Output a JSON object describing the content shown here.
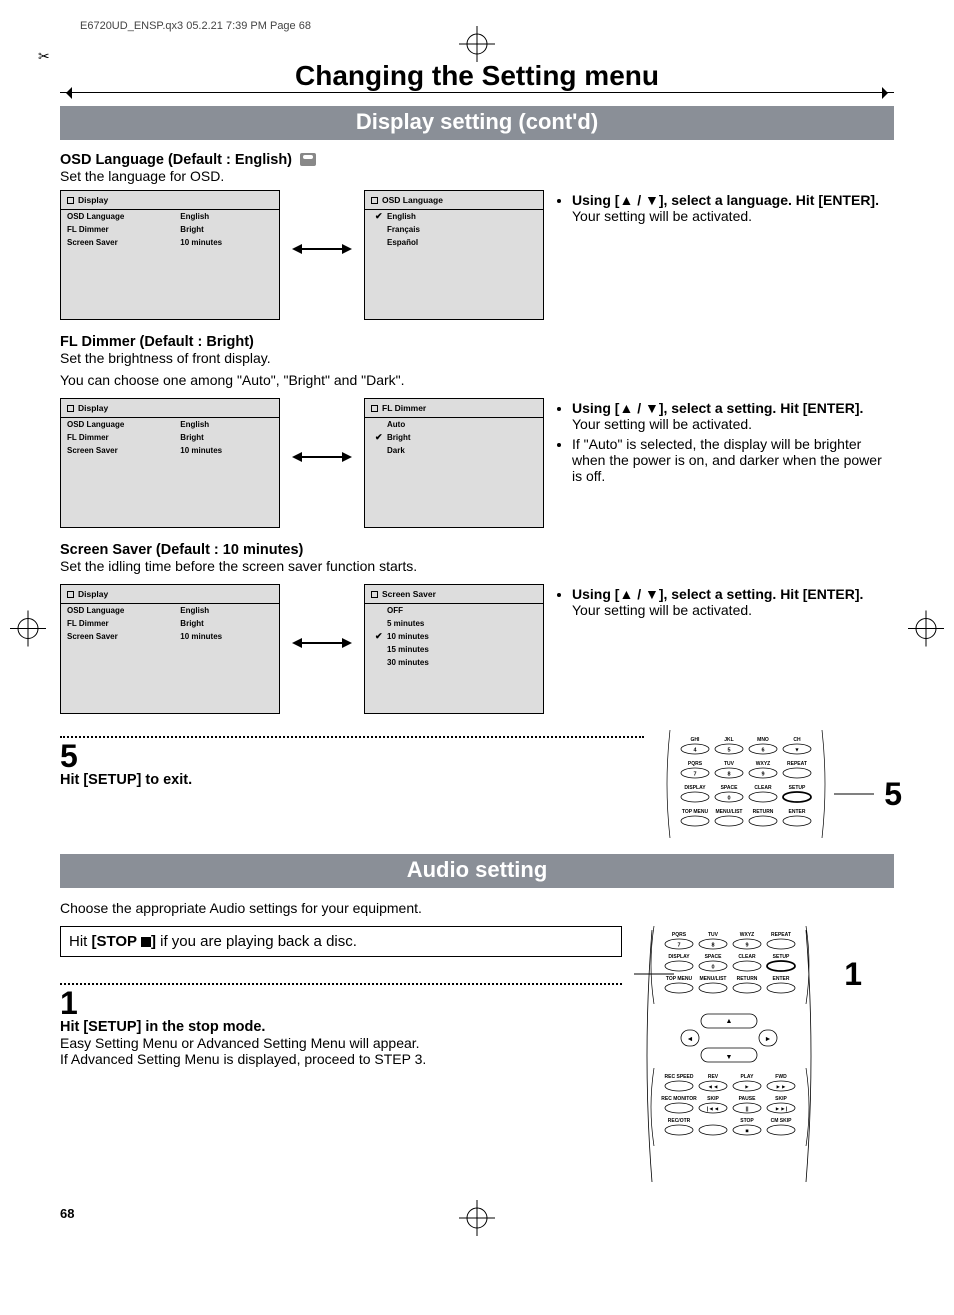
{
  "print_header": "E6720UD_ENSP.qx3  05.2.21 7:39 PM  Page 68",
  "page_number": "68",
  "chapter_title": "Changing the Setting menu",
  "band1": "Display setting (cont'd)",
  "band2": "Audio setting",
  "osd_lang": {
    "heading": "OSD Language (Default : English)",
    "sub": "Set the language for OSD.",
    "left_panel": {
      "title": "Display",
      "rows": [
        {
          "k": "OSD Language",
          "v": "English"
        },
        {
          "k": "FL Dimmer",
          "v": "Bright"
        },
        {
          "k": "Screen Saver",
          "v": "10 minutes"
        }
      ]
    },
    "right_panel": {
      "title": "OSD Language",
      "options": [
        "English",
        "Français",
        "Español"
      ],
      "selected": "English"
    },
    "instr_bold": "Using [▲ / ▼], select a language. Hit [ENTER].",
    "instr_plain": "Your setting will be activated."
  },
  "fl_dimmer": {
    "heading": "FL Dimmer (Default : Bright)",
    "sub1": "Set the brightness of front display.",
    "sub2": "You can choose one among \"Auto\", \"Bright\" and \"Dark\".",
    "left_panel": {
      "title": "Display",
      "rows": [
        {
          "k": "OSD Language",
          "v": "English"
        },
        {
          "k": "FL Dimmer",
          "v": "Bright"
        },
        {
          "k": "Screen Saver",
          "v": "10 minutes"
        }
      ]
    },
    "right_panel": {
      "title": "FL Dimmer",
      "options": [
        "Auto",
        "Bright",
        "Dark"
      ],
      "selected": "Bright"
    },
    "instr_bold": "Using [▲ / ▼], select a setting. Hit [ENTER].",
    "instr_plain": "Your setting will be activated.",
    "instr2": "If \"Auto\" is selected, the display will be brighter when the power is on, and darker when the power is off."
  },
  "screen_saver": {
    "heading": "Screen Saver (Default : 10 minutes)",
    "sub": "Set the idling time before the screen saver function starts.",
    "left_panel": {
      "title": "Display",
      "rows": [
        {
          "k": "OSD Language",
          "v": "English"
        },
        {
          "k": "FL Dimmer",
          "v": "Bright"
        },
        {
          "k": "Screen Saver",
          "v": "10 minutes"
        }
      ]
    },
    "right_panel": {
      "title": "Screen Saver",
      "options": [
        "OFF",
        "5 minutes",
        "10 minutes",
        "15 minutes",
        "30 minutes"
      ],
      "selected": "10 minutes"
    },
    "instr_bold": "Using [▲ / ▼], select a setting. Hit [ENTER].",
    "instr_plain": "Your setting will be activated."
  },
  "step5": {
    "no": "5",
    "text": "Hit [SETUP] to exit.",
    "callout": "5",
    "remote_rows": [
      [
        "GHI",
        "JKL",
        "MNO",
        "CH"
      ],
      [
        "4",
        "5",
        "6",
        "▼"
      ],
      [
        "PQRS",
        "TUV",
        "WXYZ",
        "REPEAT"
      ],
      [
        "7",
        "8",
        "9",
        ""
      ],
      [
        "DISPLAY",
        "SPACE",
        "CLEAR",
        "SETUP"
      ],
      [
        "",
        "0",
        "",
        ""
      ],
      [
        "TOP MENU",
        "MENU/LIST",
        "RETURN",
        "ENTER"
      ]
    ]
  },
  "audio_intro": "Choose the appropriate Audio settings for your equipment.",
  "stop_note_pre": "Hit ",
  "stop_note_bold": "[STOP ",
  "stop_note_post": "] ",
  "stop_note_tail": "if you are playing back a disc.",
  "step1": {
    "no": "1",
    "line1": "Hit [SETUP] in the stop mode.",
    "line2": "Easy Setting Menu or Advanced Setting Menu will appear.",
    "line3": "If Advanced Setting Menu is displayed, proceed to STEP 3.",
    "callout": "1",
    "remote_rows_top": [
      [
        "PQRS",
        "TUV",
        "WXYZ",
        "REPEAT"
      ],
      [
        "7",
        "8",
        "9",
        ""
      ],
      [
        "DISPLAY",
        "SPACE",
        "CLEAR",
        "SETUP"
      ],
      [
        "",
        "0",
        "",
        ""
      ],
      [
        "TOP MENU",
        "MENU/LIST",
        "RETURN",
        "ENTER"
      ]
    ],
    "dpad": {
      "up": "▲",
      "down": "▼",
      "left": "◄",
      "right": "►"
    },
    "remote_rows_bot": [
      [
        "REC SPEED",
        "REV",
        "PLAY",
        "FWD"
      ],
      [
        "",
        "◄◄",
        "►",
        "►►"
      ],
      [
        "REC MONITOR",
        "SKIP",
        "PAUSE",
        "SKIP"
      ],
      [
        "",
        "|◄◄",
        "||",
        "►►|"
      ],
      [
        "REC/OTR",
        "",
        "STOP",
        "CM SKIP"
      ],
      [
        "",
        "",
        "■",
        ""
      ]
    ]
  }
}
